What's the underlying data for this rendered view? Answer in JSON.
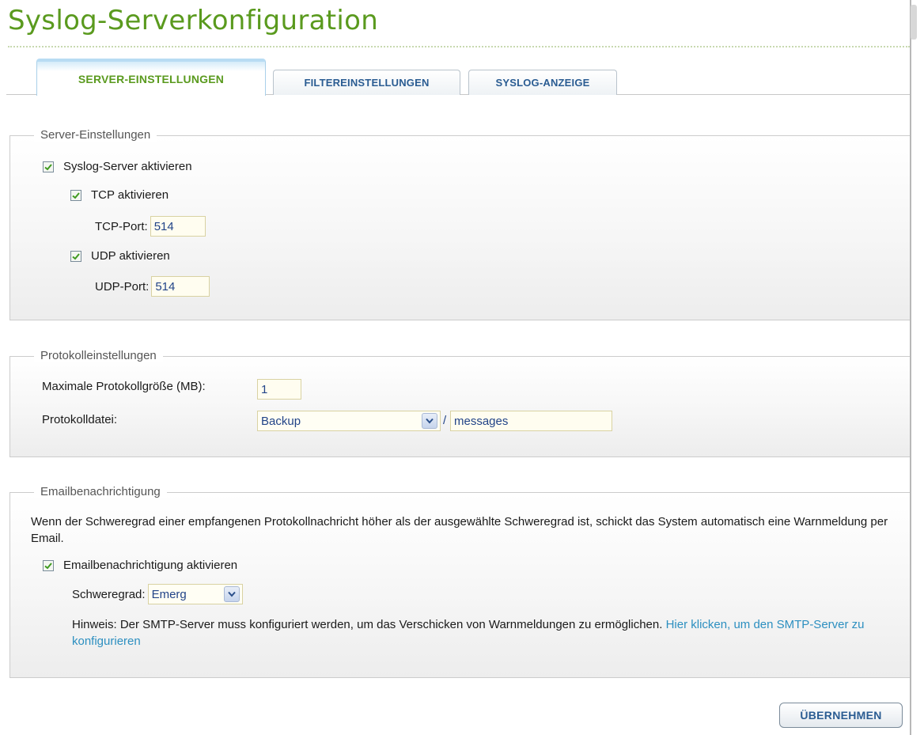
{
  "page": {
    "title": "Syslog-Serverkonfiguration"
  },
  "tabs": [
    {
      "label": "SERVER-EINSTELLUNGEN",
      "active": true
    },
    {
      "label": "FILTEREINSTELLUNGEN",
      "active": false
    },
    {
      "label": "SYSLOG-ANZEIGE",
      "active": false
    }
  ],
  "server_settings": {
    "legend": "Server-Einstellungen",
    "enable_syslog": {
      "label": "Syslog-Server aktivieren",
      "checked": true
    },
    "enable_tcp": {
      "label": "TCP aktivieren",
      "checked": true
    },
    "tcp_port": {
      "label": "TCP-Port:",
      "value": "514"
    },
    "enable_udp": {
      "label": "UDP aktivieren",
      "checked": true
    },
    "udp_port": {
      "label": "UDP-Port:",
      "value": "514"
    }
  },
  "log_settings": {
    "legend": "Protokolleinstellungen",
    "max_size": {
      "label": "Maximale Protokollgröße (MB):",
      "value": "1"
    },
    "log_file": {
      "label": "Protokolldatei:",
      "folder": "Backup",
      "separator": "/",
      "filename": "messages"
    }
  },
  "email_notification": {
    "legend": "Emailbenachrichtigung",
    "description": "Wenn der Schweregrad einer empfangenen Protokollnachricht höher als der ausgewählte Schweregrad ist, schickt das System automatisch eine Warnmeldung per Email.",
    "enable": {
      "label": "Emailbenachrichtigung aktivieren",
      "checked": true
    },
    "severity": {
      "label": "Schweregrad:",
      "value": "Emerg"
    },
    "hint_text": "Hinweis: Der SMTP-Server muss konfiguriert werden, um das Verschicken von Warnmeldungen zu ermöglichen.",
    "hint_link": "Hier klicken, um den SMTP-Server zu konfigurieren"
  },
  "actions": {
    "apply_label": "ÜBERNEHMEN"
  },
  "icons": {
    "checkbox": "checkmark-icon",
    "dropdown": "chevron-down-icon"
  },
  "colors": {
    "title": "#5a9a1e",
    "tab_text": "#2a5c92",
    "link": "#2c8fc0",
    "check": "#3f9a1f"
  }
}
